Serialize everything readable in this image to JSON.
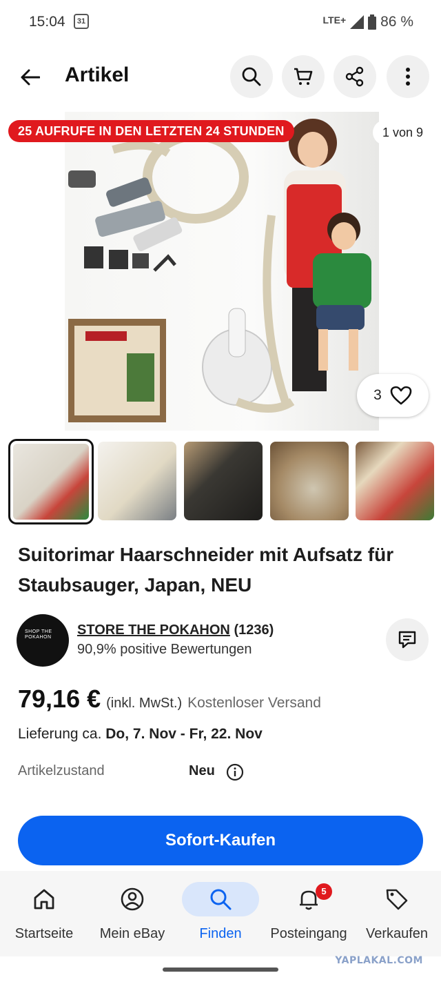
{
  "status_bar": {
    "time": "15:04",
    "calendar_day": "31",
    "network": "LTE+",
    "battery": "86 %"
  },
  "header": {
    "title": "Artikel",
    "icons": [
      "back-arrow-icon",
      "search-icon",
      "cart-icon",
      "share-icon",
      "more-icon"
    ]
  },
  "gallery": {
    "views_badge": "25 AUFRUFE IN DEN LETZTEN 24 STUNDEN",
    "counter": "1 von 9",
    "watch_count": "3",
    "thumbnails": [
      {
        "label": "thumb-1",
        "color": "#d9d3c6"
      },
      {
        "label": "thumb-2",
        "color": "#e8e4dc"
      },
      {
        "label": "thumb-3",
        "color": "#3a3833"
      },
      {
        "label": "thumb-4",
        "color": "#a58a66"
      },
      {
        "label": "thumb-5",
        "color": "#7d5c3e"
      }
    ]
  },
  "item": {
    "title": "Suitorimar Haarschneider mit Aufsatz für Staubsauger, Japan, NEU"
  },
  "seller": {
    "logo_text": "SHOP THE POKAHON",
    "name": "STORE THE POKAHON",
    "count": "(1236)",
    "feedback": "90,9% positive Bewertungen"
  },
  "price": {
    "amount": "79,16 €",
    "vat": "(inkl. MwSt.)",
    "shipping": "Kostenloser Versand"
  },
  "delivery": {
    "prefix": "Lieferung ca.",
    "range": "Do, 7. Nov - Fr, 22. Nov"
  },
  "condition": {
    "label": "Artikelzustand",
    "value": "Neu"
  },
  "buy_button": "Sofort-Kaufen",
  "bottom_nav": {
    "items": [
      {
        "label": "Startseite",
        "icon": "home-icon"
      },
      {
        "label": "Mein eBay",
        "icon": "account-icon"
      },
      {
        "label": "Finden",
        "icon": "search-icon",
        "active": true
      },
      {
        "label": "Posteingang",
        "icon": "bell-icon",
        "badge": "5"
      },
      {
        "label": "Verkaufen",
        "icon": "tag-icon"
      }
    ]
  },
  "watermark": "YAPLAKAL.COM",
  "colors": {
    "accent": "#0b63f0",
    "badge_red": "#e0191e",
    "nav_active_bg": "#d9e6fb"
  }
}
